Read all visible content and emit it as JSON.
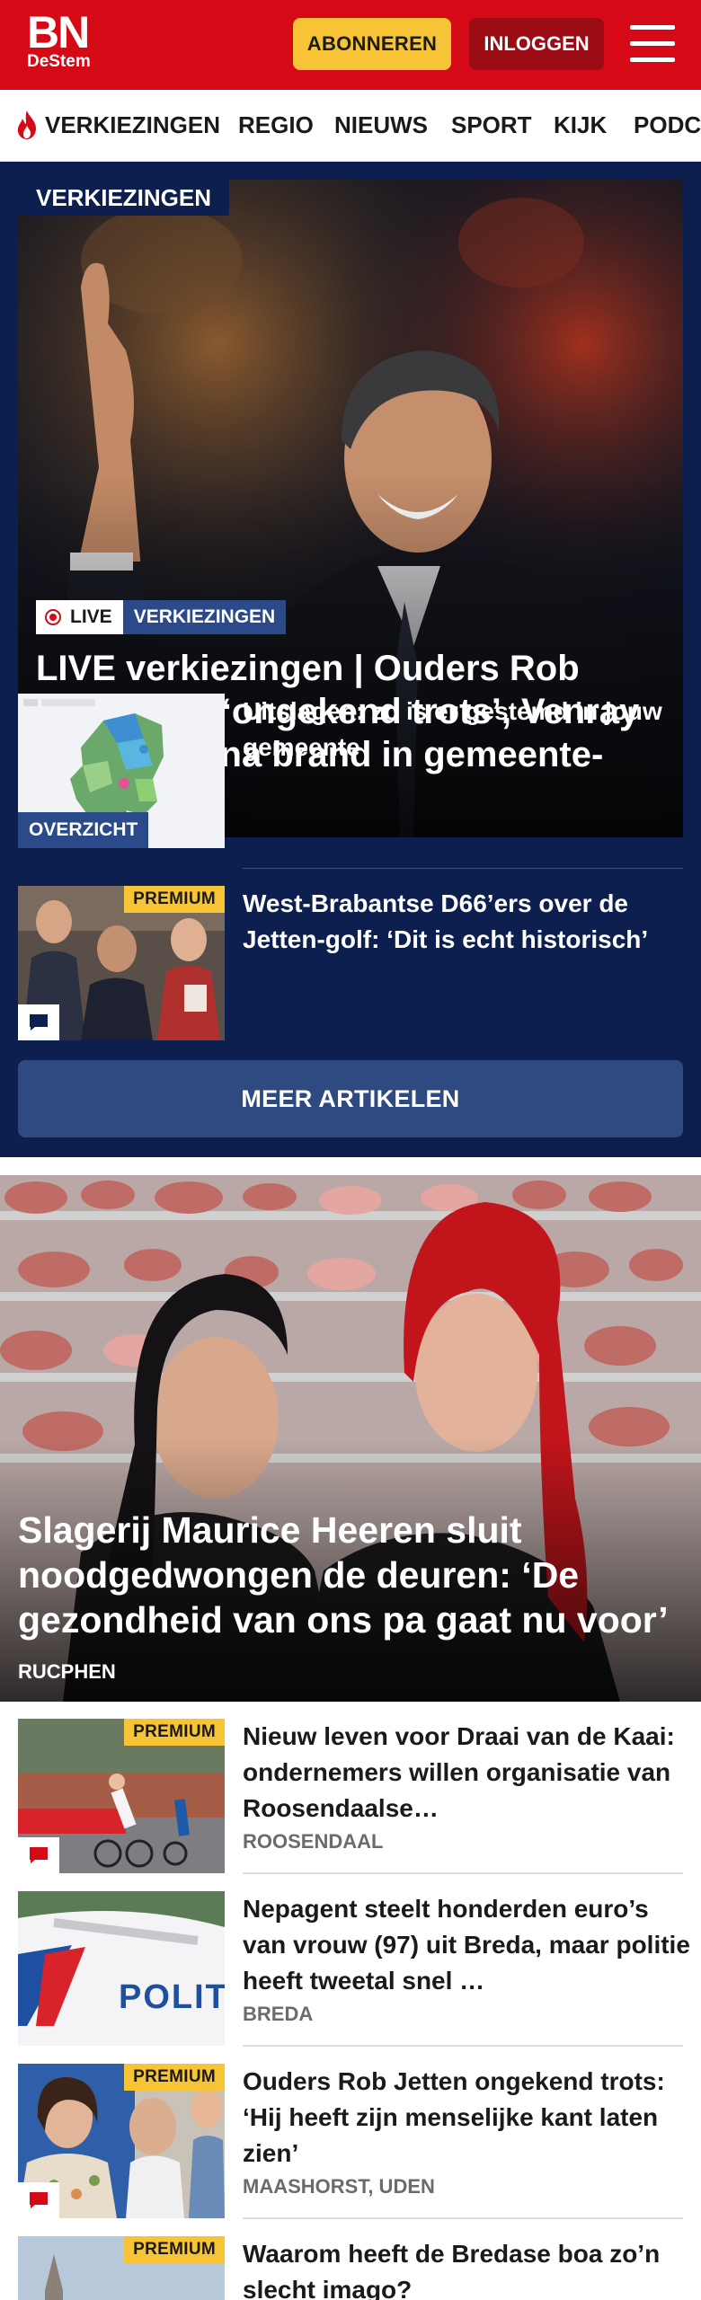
{
  "header": {
    "logo_top": "BN",
    "logo_bottom": "DeStem",
    "subscribe_label": "ABONNEREN",
    "login_label": "INLOGGEN",
    "brand_color": "#d50a16"
  },
  "nav": {
    "items": [
      {
        "label": "VERKIEZINGEN",
        "icon": "flame-icon"
      },
      {
        "label": "REGIO"
      },
      {
        "label": "NIEUWS"
      },
      {
        "label": "SPORT"
      },
      {
        "label": "KIJK"
      },
      {
        "label": "PODCAST"
      }
    ]
  },
  "election": {
    "section_label": "VERKIEZINGEN",
    "hero": {
      "live_label": "LIVE",
      "category_label": "VERKIEZINGEN",
      "title": "LIVE verkiezingen | Ouders Rob Jetten zijn ‘ongekend trots’, Venray telt verder na brand in gemeente­huis"
    },
    "items": [
      {
        "title": "Uitslagen: zo is er gestemd in jouw gemeente",
        "tag": "OVERZICHT"
      },
      {
        "title": "West-Brabantse D66’ers over de Jetten-golf: ‘Dit is echt historisch’",
        "badge": "PREMIUM",
        "icon": "comment-icon"
      }
    ],
    "more_label": "MEER ARTIKELEN"
  },
  "feature": {
    "title": "Slagerij Maurice Heeren sluit noodgedwongen de deuren: ‘De gezondheid van ons pa gaat nu voor’",
    "location": "RUCPHEN"
  },
  "list": [
    {
      "title": "Nieuw leven voor Draai van de Kaai: ondernemers willen organisatie van Roosendaalse…",
      "location": "ROOSENDAAL",
      "badge": "PREMIUM",
      "icon": "comment-icon"
    },
    {
      "title": "Nepagent steelt honderden euro’s van vrouw (97) uit Breda, maar politie heeft tweetal snel …",
      "location": "BREDA",
      "thumb_text": "POLITIE"
    },
    {
      "title": "Ouders Rob Jetten ongekend trots: ‘Hij heeft zijn menselijke kant laten zien’",
      "location": "MAASHORST, UDEN",
      "badge": "PREMIUM",
      "icon": "comment-icon"
    },
    {
      "title": "Waarom heeft de Bredase boa zo’n slecht imago?",
      "badge": "PREMIUM"
    }
  ]
}
